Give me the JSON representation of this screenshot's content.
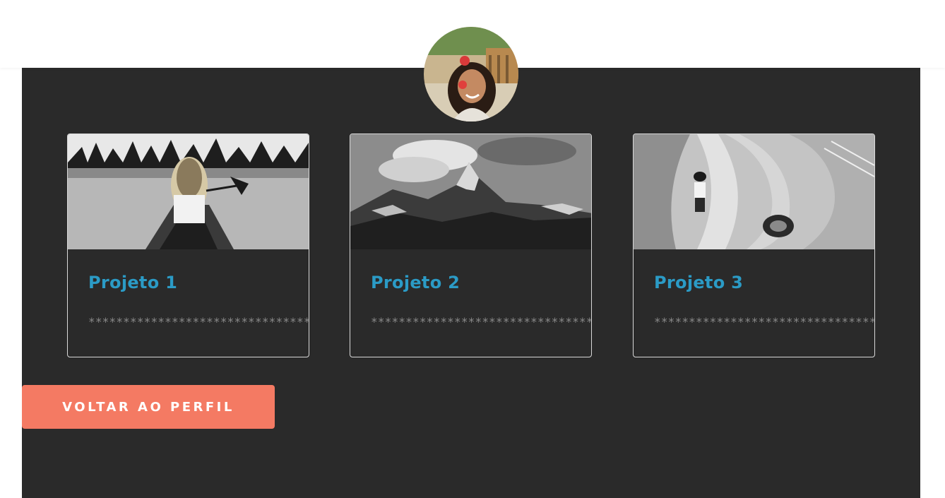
{
  "profile": {
    "avatar_icon": "profile-photo-avatar"
  },
  "projects": [
    {
      "title": "Projeto 1",
      "description": "***************************************",
      "image_icon": "canoe-lake-photo"
    },
    {
      "title": "Projeto 2",
      "description": "***************************************",
      "image_icon": "mountain-peak-photo"
    },
    {
      "title": "Projeto 3",
      "description": "***************************************",
      "image_icon": "spiral-staircase-photo"
    }
  ],
  "actions": {
    "back_label": "VOLTAR AO PERFIL"
  },
  "colors": {
    "panel_background": "#2a2a2a",
    "project_title": "#2b9bc6",
    "button_background": "#f47a63",
    "description_text": "#8a8a8a",
    "card_border": "#d9d9d9"
  }
}
